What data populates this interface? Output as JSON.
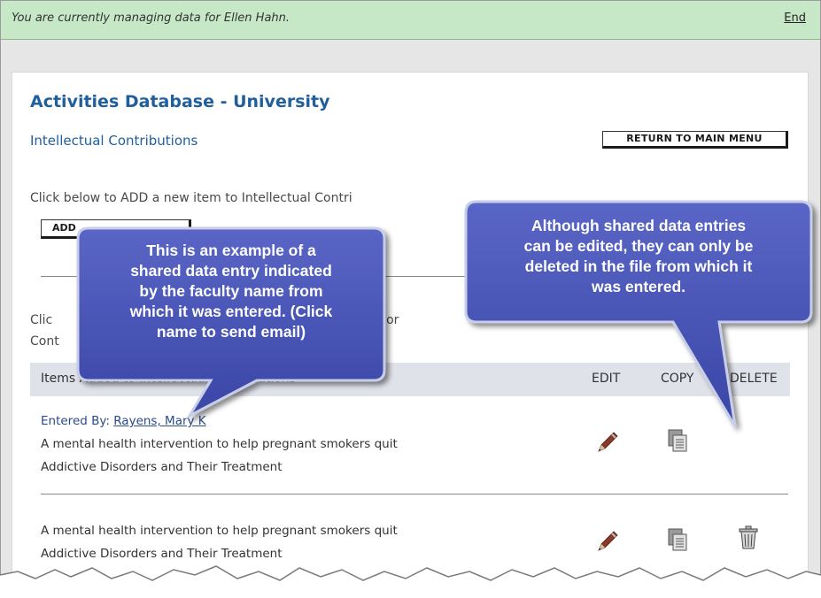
{
  "notice": {
    "text": "You are currently managing data for Ellen Hahn.",
    "end_link": "End"
  },
  "header": {
    "database_title": "Activities Database - University",
    "section_title": "Intellectual Contributions",
    "return_button": "RETURN TO MAIN MENU"
  },
  "add_section": {
    "instruction": "Click below to ADD a new item to Intellectual Contri",
    "add_button": "ADD"
  },
  "list_section": {
    "instruction_line1_a": "Clic",
    "instruction_line1_b": "COPY or",
    "instruction_line2": "Cont",
    "columns": {
      "items": "Items Added to Intellectual Contributions",
      "edit": "EDIT",
      "copy": "COPY",
      "delete": "DELETE"
    }
  },
  "items": [
    {
      "entered_by_label": "Entered By: ",
      "entered_by_name": "Rayens, Mary K",
      "title": "A mental health intervention to help pregnant smokers quit",
      "journal": "Addictive Disorders and Their Treatment"
    },
    {
      "title": "A mental health intervention to help pregnant smokers quit",
      "journal": "Addictive Disorders and Their Treatment"
    }
  ],
  "callouts": {
    "left": [
      "This is an example of a",
      "shared data entry indicated",
      "by the faculty name from",
      "which it was entered. (Click",
      "name to send email)"
    ],
    "right": [
      "Although shared data entries",
      "can be edited, they can only be",
      "deleted in the file from which it",
      "was entered."
    ]
  },
  "icons": {
    "edit": "pencil-icon",
    "copy": "copy-icon",
    "delete": "trash-icon"
  },
  "colors": {
    "notice_bg": "#c7e8c7",
    "title_blue": "#1f5f9e",
    "callout_fill": "#4a56b6",
    "header_row_bg": "#e0e2ea"
  }
}
